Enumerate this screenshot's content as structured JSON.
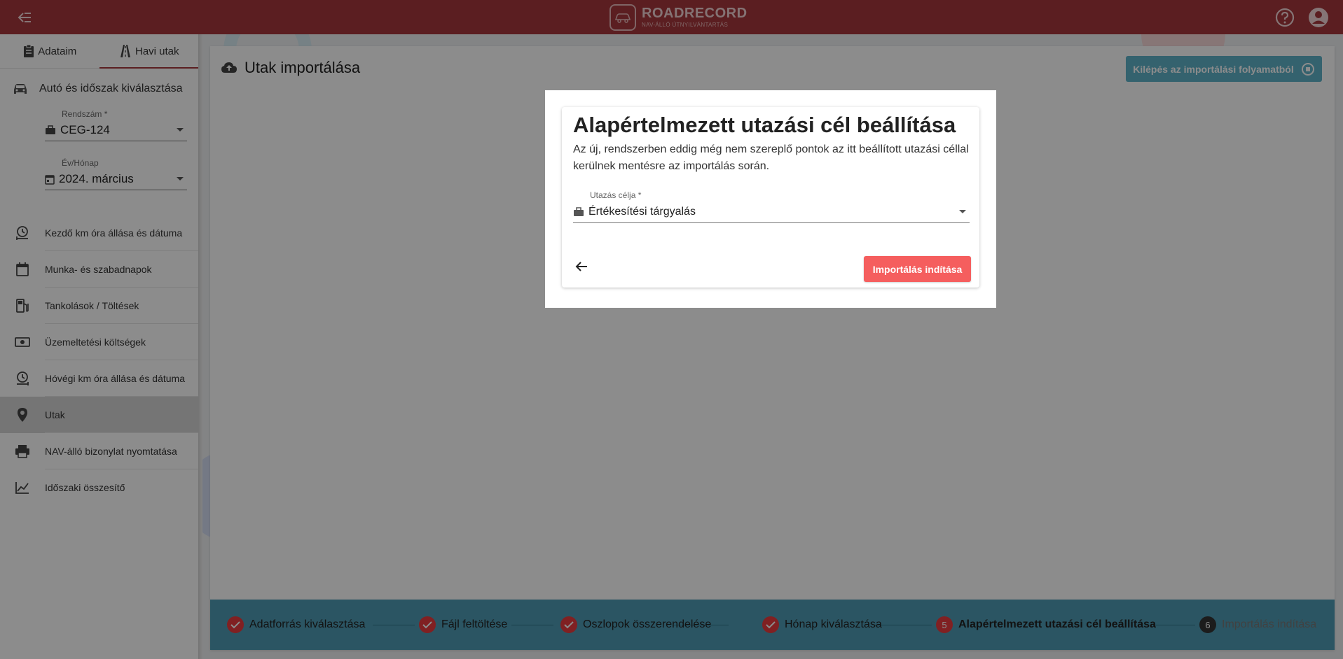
{
  "header": {
    "brand_title": "ROADRECORD",
    "brand_subtitle": "NAV-ÁLLÓ ÚTNYILVÁNTARTÁS",
    "icons": [
      "menu-collapse-icon",
      "help-icon",
      "account-icon"
    ],
    "brand_color": "#a6383c"
  },
  "sidebar": {
    "tabs": [
      {
        "label": "Adataim",
        "icon": "clipboard-icon",
        "active": false
      },
      {
        "label": "Havi utak",
        "icon": "road-icon",
        "active": true
      }
    ],
    "section_title": "Autó és időszak kiválasztása",
    "plate": {
      "label": "Rendszám *",
      "value": "CEG-124"
    },
    "period": {
      "label": "Év/Hónap",
      "value": "2024. március"
    },
    "items": [
      {
        "label": "Kezdő km óra állása és dátuma",
        "icon": "odometer-start-icon"
      },
      {
        "label": "Munka- és szabadnapok",
        "icon": "calendar-icon"
      },
      {
        "label": "Tankolások / Töltések",
        "icon": "fuel-icon"
      },
      {
        "label": "Üzemeltetési költségek",
        "icon": "money-icon"
      },
      {
        "label": "Hóvégi km óra állása és dátuma",
        "icon": "odometer-end-icon"
      },
      {
        "label": "Utak",
        "icon": "location-pin-icon",
        "active": true
      },
      {
        "label": "NAV-álló bizonylat nyomtatása",
        "icon": "printer-icon"
      },
      {
        "label": "Időszaki összesítő",
        "icon": "chart-line-icon"
      }
    ]
  },
  "main": {
    "title": "Utak importálása",
    "exit_button": "Kilépés az importálási folyamatból"
  },
  "stepper": {
    "steps": [
      {
        "label": "Adatforrás kiválasztása",
        "status": "done"
      },
      {
        "label": "Fájl feltöltése",
        "status": "done"
      },
      {
        "label": "Oszlopok összerendelése",
        "status": "done"
      },
      {
        "label": "Hónap kiválasztása",
        "status": "done"
      },
      {
        "label": "Alapértelmezett utazási cél beállítása",
        "status": "current",
        "number": "5"
      },
      {
        "label": "Importálás indítása",
        "status": "future",
        "number": "6"
      }
    ]
  },
  "dialog": {
    "title": "Alapértelmezett utazási cél beállítása",
    "description": "Az új, rendszerben eddig még nem szereplő pontok az itt beállított utazási céllal kerülnek mentésre az importálás során.",
    "purpose_label": "Utazás célja *",
    "purpose_value": "Értékesítési tárgyalás",
    "start_button": "Importálás indítása",
    "accent_color": "#f55e5e"
  }
}
